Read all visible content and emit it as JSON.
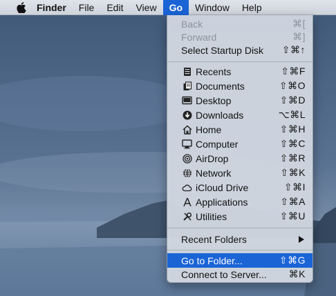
{
  "menubar": {
    "app_name": "Finder",
    "items": [
      "File",
      "Edit",
      "View",
      "Go",
      "Window",
      "Help"
    ],
    "active_item": "Go"
  },
  "go_menu": {
    "items": [
      {
        "label": "Back",
        "shortcut": "⌘[",
        "disabled": true
      },
      {
        "label": "Forward",
        "shortcut": "⌘]",
        "disabled": true
      },
      {
        "label": "Select Startup Disk",
        "shortcut": "⇧⌘↑"
      },
      {
        "label": "Recents",
        "shortcut": "⇧⌘F",
        "icon": "recents-icon"
      },
      {
        "label": "Documents",
        "shortcut": "⇧⌘O",
        "icon": "documents-icon"
      },
      {
        "label": "Desktop",
        "shortcut": "⇧⌘D",
        "icon": "desktop-icon"
      },
      {
        "label": "Downloads",
        "shortcut": "⌥⌘L",
        "icon": "downloads-icon"
      },
      {
        "label": "Home",
        "shortcut": "⇧⌘H",
        "icon": "home-icon"
      },
      {
        "label": "Computer",
        "shortcut": "⇧⌘C",
        "icon": "computer-icon"
      },
      {
        "label": "AirDrop",
        "shortcut": "⇧⌘R",
        "icon": "airdrop-icon"
      },
      {
        "label": "Network",
        "shortcut": "⇧⌘K",
        "icon": "network-icon"
      },
      {
        "label": "iCloud Drive",
        "shortcut": "⇧⌘I",
        "icon": "icloud-icon"
      },
      {
        "label": "Applications",
        "shortcut": "⇧⌘A",
        "icon": "applications-icon"
      },
      {
        "label": "Utilities",
        "shortcut": "⇧⌘U",
        "icon": "utilities-icon"
      },
      {
        "label": "Recent Folders",
        "submenu": true
      },
      {
        "label": "Go to Folder...",
        "shortcut": "⇧⌘G",
        "highlighted": true
      },
      {
        "label": "Connect to Server...",
        "shortcut": "⌘K"
      }
    ]
  },
  "colors": {
    "highlight": "#1a64d6",
    "menu_background": "#d0d6e0",
    "desktop_sky": "#4b6484",
    "desktop_sea": "#7690ad"
  }
}
